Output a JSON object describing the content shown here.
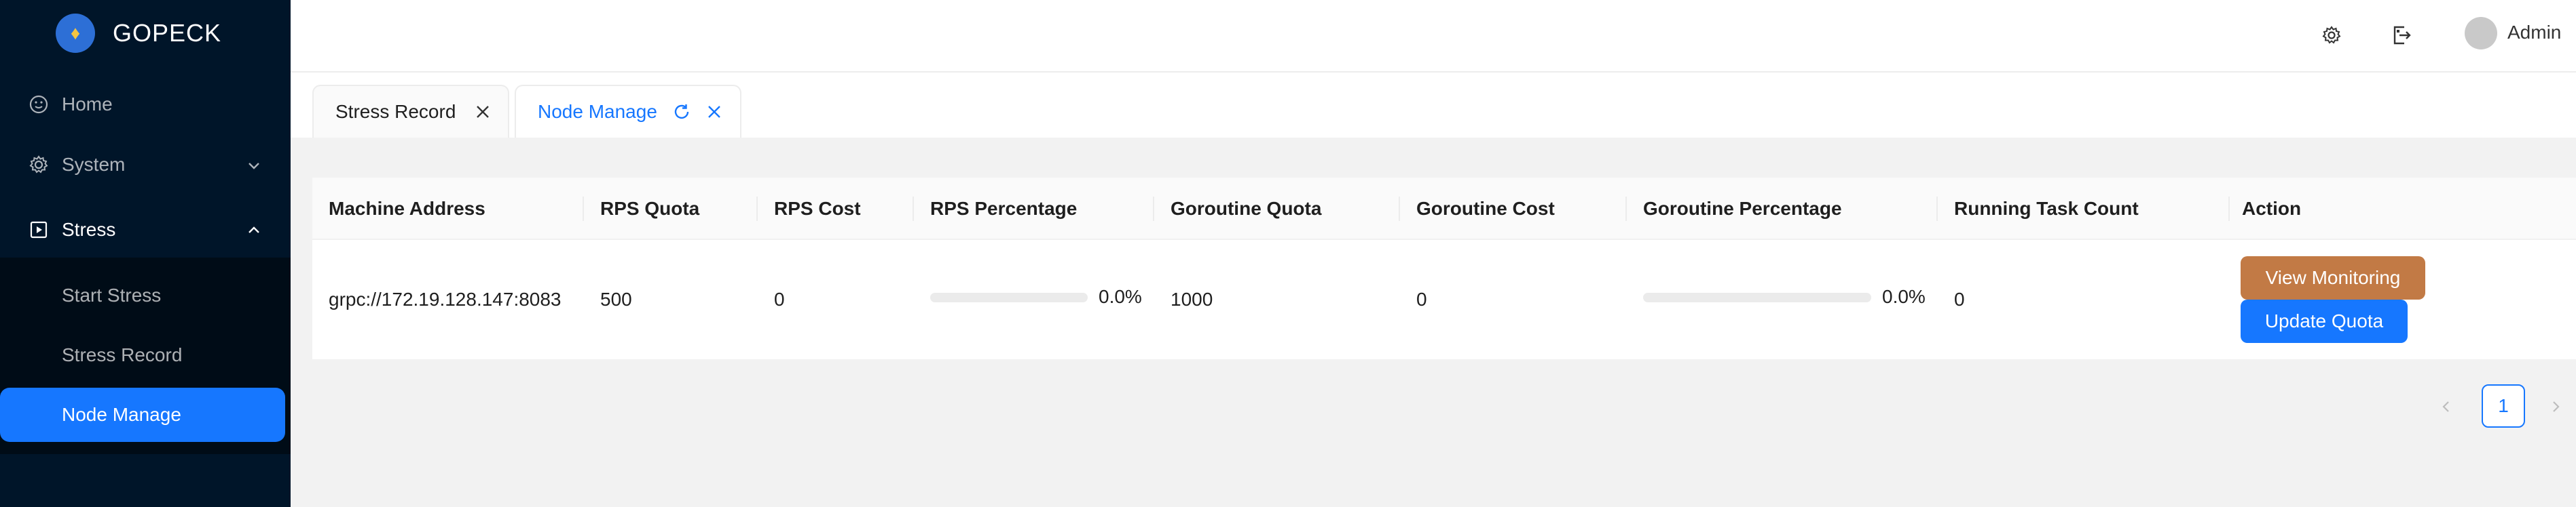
{
  "app": {
    "name": "GOPECK"
  },
  "sidebar": {
    "items": [
      {
        "label": "Home",
        "icon": "smile-icon"
      },
      {
        "label": "System",
        "icon": "gear-icon",
        "expanded": false
      },
      {
        "label": "Stress",
        "icon": "play-square-icon",
        "expanded": true,
        "children": [
          {
            "label": "Start Stress",
            "active": false
          },
          {
            "label": "Stress Record",
            "active": false
          },
          {
            "label": "Node Manage",
            "active": true
          }
        ]
      }
    ]
  },
  "header": {
    "icons": [
      "gear-icon",
      "export-icon"
    ],
    "user": {
      "name": "Admin"
    }
  },
  "tabs": [
    {
      "label": "Stress Record",
      "active": false
    },
    {
      "label": "Node Manage",
      "active": true
    }
  ],
  "table": {
    "columns": [
      "Machine Address",
      "RPS Quota",
      "RPS Cost",
      "RPS Percentage",
      "Goroutine Quota",
      "Goroutine Cost",
      "Goroutine Percentage",
      "Running Task Count",
      "Action"
    ],
    "rows": [
      {
        "machine_address": "grpc://172.19.128.147:8083",
        "rps_quota": "500",
        "rps_cost": "0",
        "rps_percentage": "0.0%",
        "rps_percentage_value": 0,
        "goroutine_quota": "1000",
        "goroutine_cost": "0",
        "goroutine_percentage": "0.0%",
        "goroutine_percentage_value": 0,
        "running_task_count": "0",
        "actions": {
          "view_monitoring": "View Monitoring",
          "update_quota": "Update Quota"
        }
      }
    ]
  },
  "pagination": {
    "current_page": "1"
  },
  "colors": {
    "primary": "#1677ff",
    "sidebar_bg": "#001529",
    "monitor_button": "#c27a45"
  }
}
